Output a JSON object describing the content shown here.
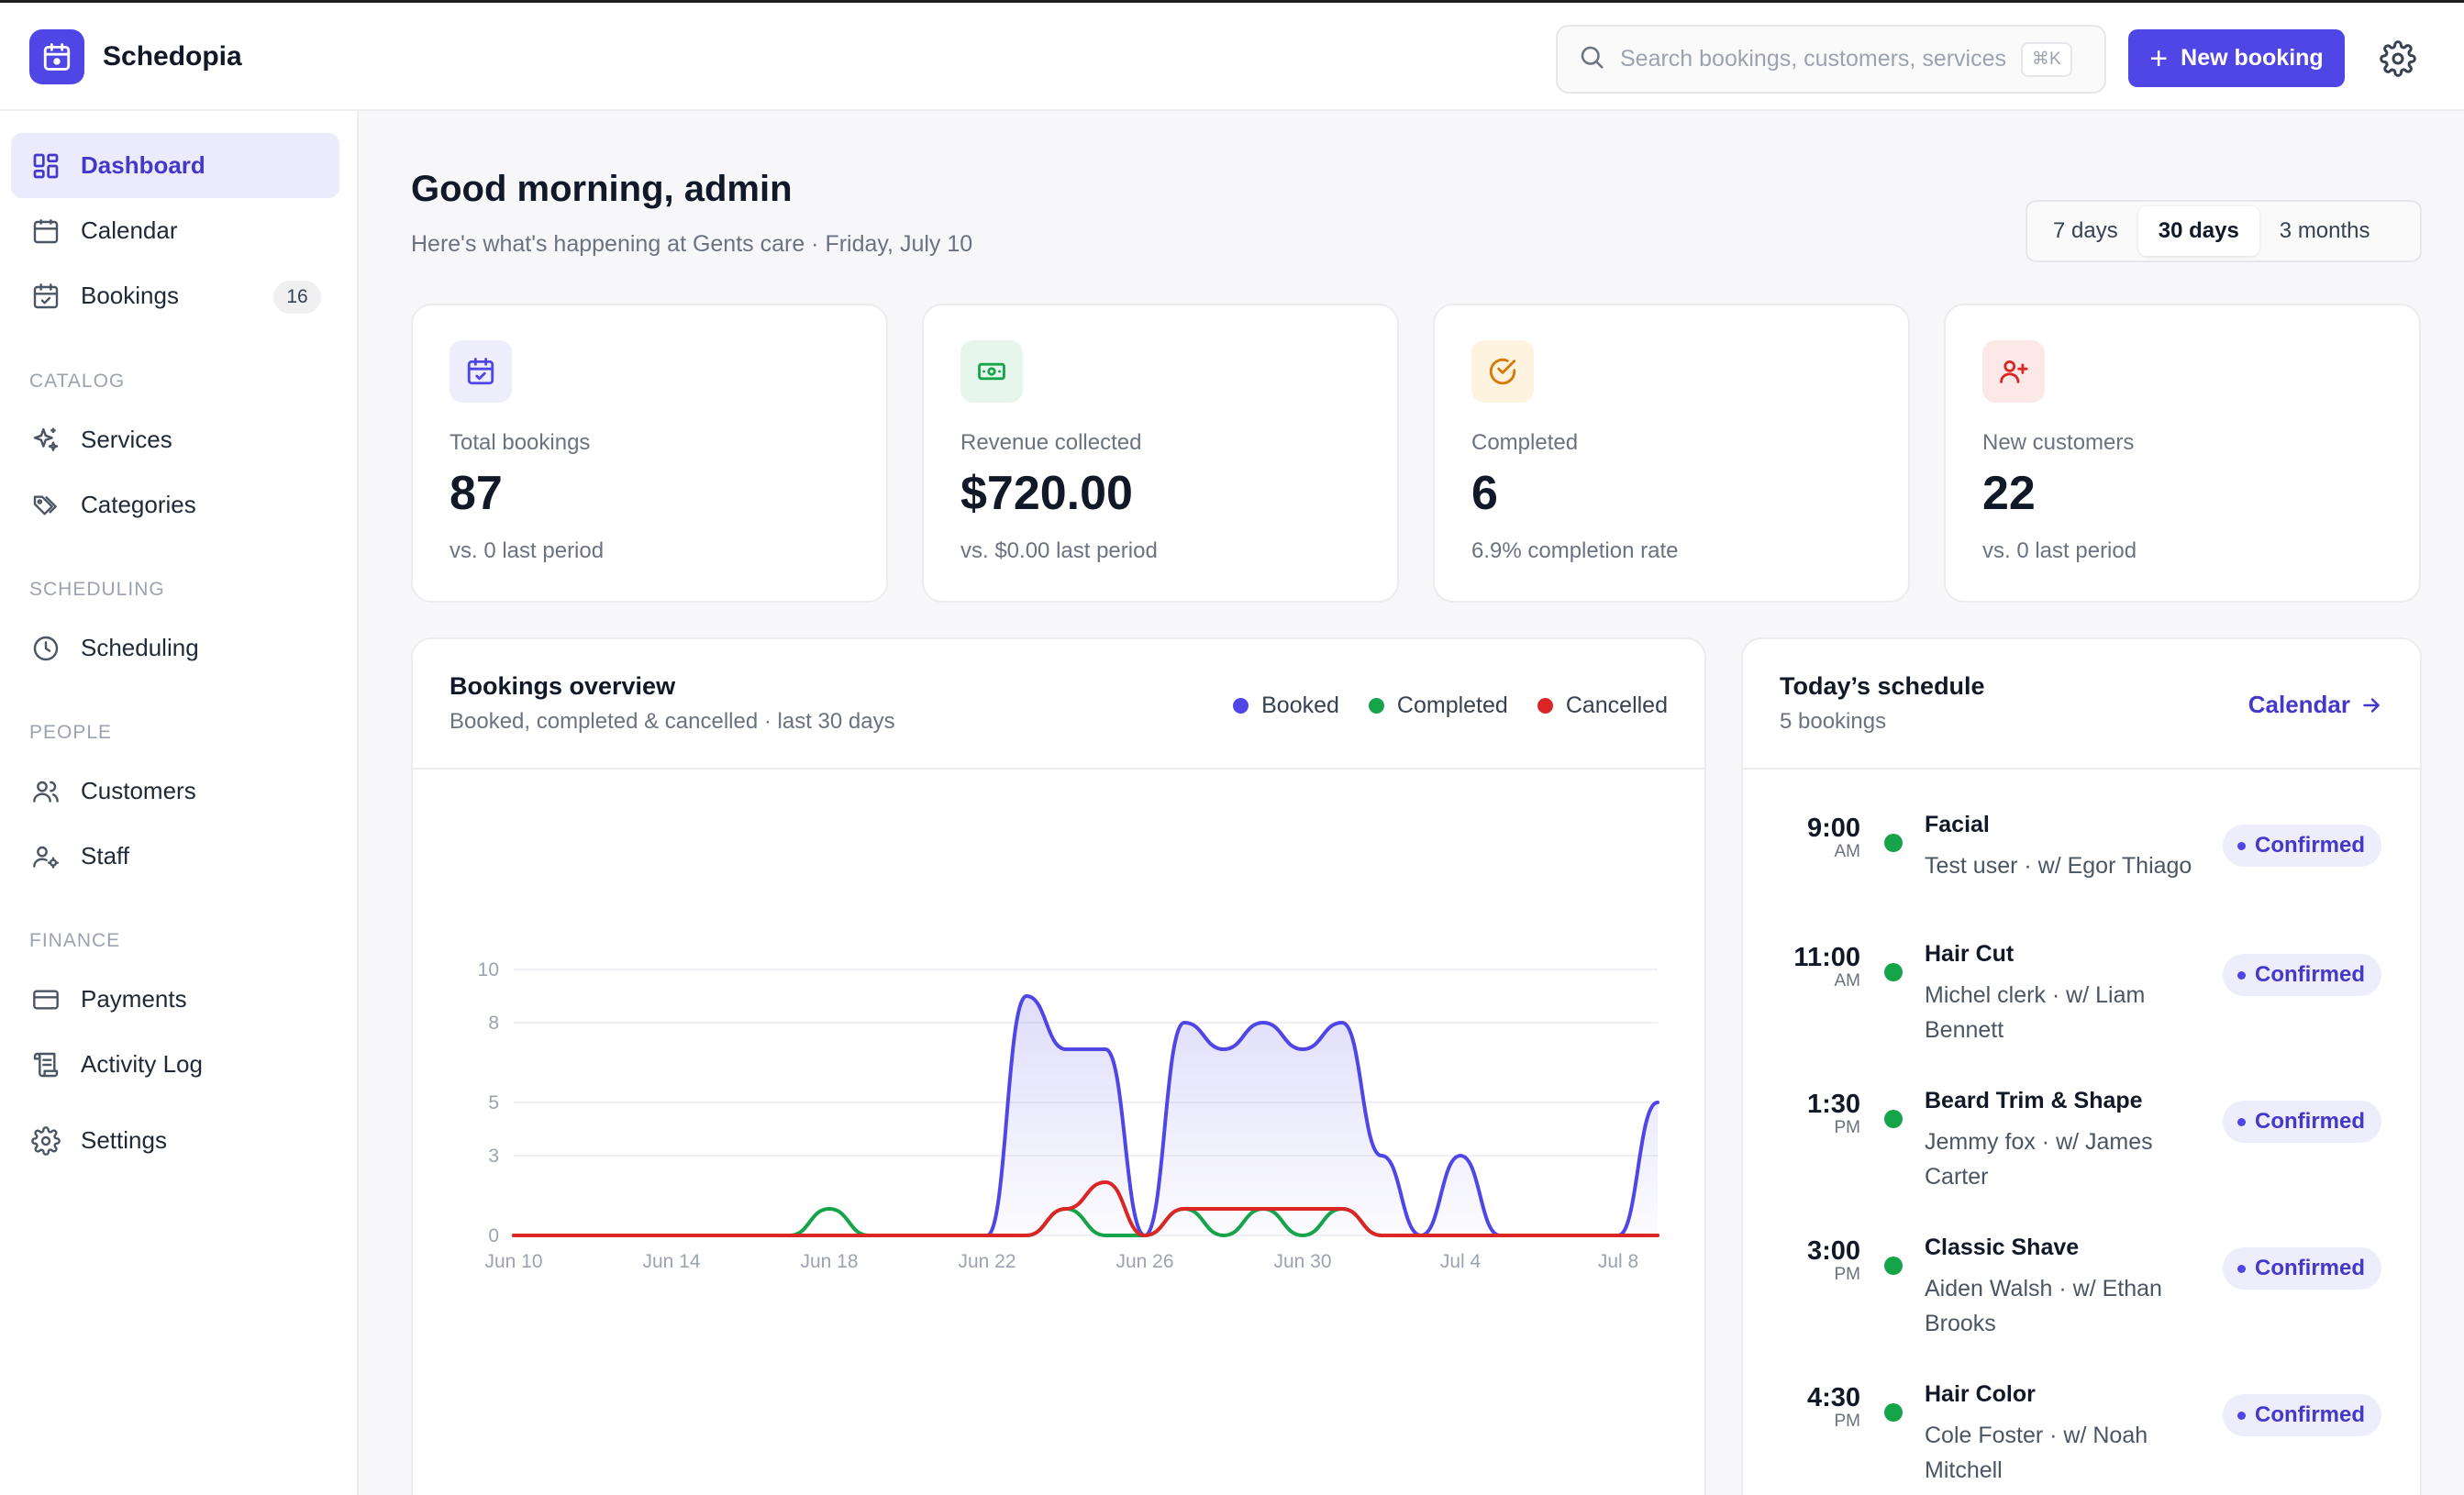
{
  "brand": {
    "name": "Schedopia"
  },
  "search": {
    "placeholder": "Search bookings, customers, services",
    "shortcut": "⌘K"
  },
  "header": {
    "new_booking_label": "New booking"
  },
  "sidebar": {
    "main": [
      {
        "label": "Dashboard",
        "icon": "grid-icon",
        "active": true
      },
      {
        "label": "Calendar",
        "icon": "calendar-icon"
      },
      {
        "label": "Bookings",
        "icon": "calendar-check-icon",
        "badge": "16"
      }
    ],
    "catalog": {
      "title": "CATALOG",
      "items": [
        {
          "label": "Services",
          "icon": "sparkles-icon"
        },
        {
          "label": "Categories",
          "icon": "tags-icon"
        }
      ]
    },
    "scheduling": {
      "title": "SCHEDULING",
      "items": [
        {
          "label": "Scheduling",
          "icon": "clock-icon"
        }
      ]
    },
    "people": {
      "title": "PEOPLE",
      "items": [
        {
          "label": "Customers",
          "icon": "users-icon"
        },
        {
          "label": "Staff",
          "icon": "user-cog-icon"
        }
      ]
    },
    "finance": {
      "title": "FINANCE",
      "items": [
        {
          "label": "Payments",
          "icon": "credit-card-icon"
        },
        {
          "label": "Activity Log",
          "icon": "scroll-icon"
        }
      ]
    },
    "settings": {
      "label": "Settings",
      "icon": "gear-icon"
    }
  },
  "page": {
    "greeting": "Good morning, admin",
    "subline": "Here's what's happening at Gents care · Friday, July 10",
    "ranges": [
      "7 days",
      "30 days",
      "3 months"
    ],
    "active_range": "30 days"
  },
  "stats": [
    {
      "label": "Total bookings",
      "value": "87",
      "sub": "vs. 0 last period",
      "icon": "calendar-check-icon",
      "color": "#4f46e5"
    },
    {
      "label": "Revenue collected",
      "value": "$720.00",
      "sub": "vs. $0.00 last period",
      "icon": "banknote-icon",
      "color": "#16a34a"
    },
    {
      "label": "Completed",
      "value": "6",
      "sub": "6.9% completion rate",
      "icon": "check-circle-icon",
      "color": "#d97706"
    },
    {
      "label": "New customers",
      "value": "22",
      "sub": "vs. 0 last period",
      "icon": "user-plus-icon",
      "color": "#dc2626"
    }
  ],
  "overview": {
    "title": "Bookings overview",
    "subtitle": "Booked, completed & cancelled · last 30 days"
  },
  "chart_data": {
    "type": "area",
    "x": [
      "Jun 10",
      "Jun 11",
      "Jun 12",
      "Jun 13",
      "Jun 14",
      "Jun 15",
      "Jun 16",
      "Jun 17",
      "Jun 18",
      "Jun 19",
      "Jun 20",
      "Jun 21",
      "Jun 22",
      "Jun 23",
      "Jun 24",
      "Jun 25",
      "Jun 26",
      "Jun 27",
      "Jun 28",
      "Jun 29",
      "Jun 30",
      "Jul 1",
      "Jul 2",
      "Jul 3",
      "Jul 4",
      "Jul 5",
      "Jul 6",
      "Jul 7",
      "Jul 8",
      "Jul 9"
    ],
    "xticks": [
      "Jun 10",
      "Jun 14",
      "Jun 18",
      "Jun 22",
      "Jun 26",
      "Jun 30",
      "Jul 4",
      "Jul 8"
    ],
    "yticks": [
      "0",
      "3",
      "5",
      "8",
      "10"
    ],
    "ylim": [
      0,
      10
    ],
    "grid": true,
    "legend": "top-right",
    "series": [
      {
        "name": "Booked",
        "color": "#4f46e5",
        "filled": true,
        "values": [
          0,
          0,
          0,
          0,
          0,
          0,
          0,
          0,
          0,
          0,
          0,
          0,
          0,
          9,
          7,
          7,
          0,
          8,
          7,
          8,
          7,
          8,
          3,
          0,
          3,
          0,
          0,
          0,
          0,
          5
        ]
      },
      {
        "name": "Completed",
        "color": "#16a34a",
        "filled": false,
        "values": [
          0,
          0,
          0,
          0,
          0,
          0,
          0,
          0,
          1,
          0,
          0,
          0,
          0,
          0,
          1,
          0,
          0,
          1,
          0,
          1,
          0,
          1,
          0,
          0,
          0,
          0,
          0,
          0,
          0,
          0
        ]
      },
      {
        "name": "Cancelled",
        "color": "#dc2626",
        "filled": false,
        "values": [
          0,
          0,
          0,
          0,
          0,
          0,
          0,
          0,
          0,
          0,
          0,
          0,
          0,
          0,
          1,
          2,
          0,
          1,
          1,
          1,
          1,
          1,
          0,
          0,
          0,
          0,
          0,
          0,
          0,
          0
        ]
      }
    ]
  },
  "schedule": {
    "title": "Today’s schedule",
    "count": "5 bookings",
    "link_label": "Calendar",
    "items": [
      {
        "time": "9:00",
        "ampm": "AM",
        "service": "Facial",
        "meta": "Test user · w/ Egor Thiago",
        "status": "Confirmed"
      },
      {
        "time": "11:00",
        "ampm": "AM",
        "service": "Hair Cut",
        "meta": "Michel clerk · w/ Liam Bennett",
        "status": "Confirmed"
      },
      {
        "time": "1:30",
        "ampm": "PM",
        "service": "Beard Trim & Shape",
        "meta": "Jemmy fox · w/ James Carter",
        "status": "Confirmed"
      },
      {
        "time": "3:00",
        "ampm": "PM",
        "service": "Classic Shave",
        "meta": "Aiden Walsh · w/ Ethan Brooks",
        "status": "Confirmed"
      },
      {
        "time": "4:30",
        "ampm": "PM",
        "service": "Hair Color",
        "meta": "Cole Foster · w/ Noah Mitchell",
        "status": "Confirmed"
      }
    ]
  },
  "colors": {
    "accent": "#4f46e5",
    "booked": "#4f46e5",
    "completed": "#16a34a",
    "cancelled": "#dc2626"
  }
}
